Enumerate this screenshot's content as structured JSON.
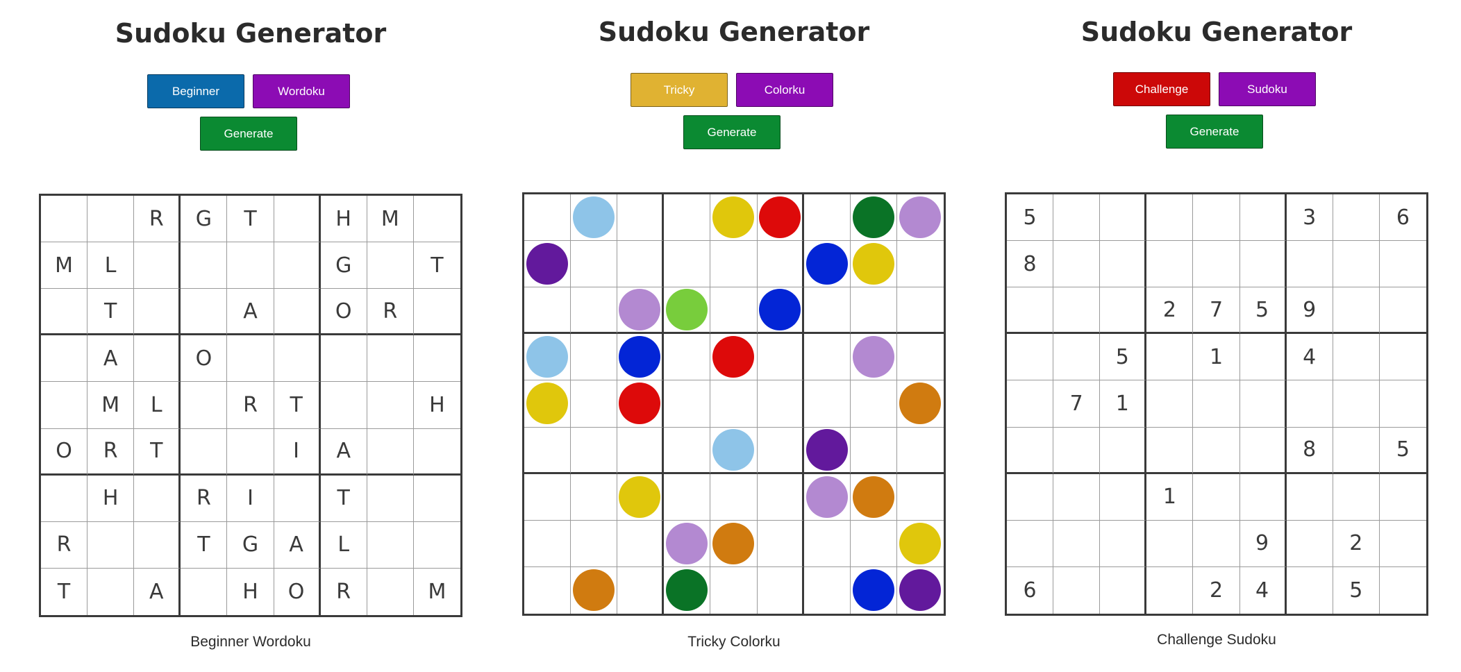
{
  "panels": [
    {
      "title": "Sudoku Generator",
      "difficulty_button": {
        "label": "Beginner",
        "color": "#0b6aab"
      },
      "mode_button": {
        "label": "Wordoku",
        "color": "#8c0cb4"
      },
      "generate_button": {
        "label": "Generate",
        "color": "#0b8a32"
      },
      "caption": "Beginner Wordoku",
      "grid_type": "text",
      "grid": [
        [
          "",
          "",
          "R",
          "G",
          "T",
          "",
          "H",
          "M",
          ""
        ],
        [
          "M",
          "L",
          "",
          "",
          "",
          "",
          "G",
          "",
          "T"
        ],
        [
          "",
          "T",
          "",
          "",
          "A",
          "",
          "O",
          "R",
          ""
        ],
        [
          "",
          "A",
          "",
          "O",
          "",
          "",
          "",
          "",
          ""
        ],
        [
          "",
          "M",
          "L",
          "",
          "R",
          "T",
          "",
          "",
          "H"
        ],
        [
          "O",
          "R",
          "T",
          "",
          "",
          "I",
          "A",
          "",
          ""
        ],
        [
          "",
          "H",
          "",
          "R",
          "I",
          "",
          "T",
          "",
          ""
        ],
        [
          "R",
          "",
          "",
          "T",
          "G",
          "A",
          "L",
          "",
          ""
        ],
        [
          "T",
          "",
          "A",
          "",
          "H",
          "O",
          "R",
          "",
          "M"
        ]
      ]
    },
    {
      "title": "Sudoku Generator",
      "difficulty_button": {
        "label": "Tricky",
        "color": "#e0b232"
      },
      "mode_button": {
        "label": "Colorku",
        "color": "#8c0cb4"
      },
      "generate_button": {
        "label": "Generate",
        "color": "#0b8a32"
      },
      "caption": "Tricky Colorku",
      "grid_type": "color",
      "palette": {
        "lb": "#8ec4e8",
        "ye": "#e0c70c",
        "re": "#dd0a0a",
        "dg": "#0a7326",
        "li": "#b389d1",
        "pu": "#62199c",
        "bl": "#0325d6",
        "lg": "#78cd3c",
        "or": "#d07b10"
      },
      "grid": [
        [
          "",
          "lb",
          "",
          "",
          "ye",
          "re",
          "",
          "dg",
          "li"
        ],
        [
          "pu",
          "",
          "",
          "",
          "",
          "",
          "bl",
          "ye",
          ""
        ],
        [
          "",
          "",
          "li",
          "lg",
          "",
          "bl",
          "",
          "",
          ""
        ],
        [
          "lb",
          "",
          "bl",
          "",
          "re",
          "",
          "",
          "li",
          ""
        ],
        [
          "ye",
          "",
          "re",
          "",
          "",
          "",
          "",
          "",
          "or"
        ],
        [
          "",
          "",
          "",
          "",
          "lb",
          "",
          "pu",
          "",
          ""
        ],
        [
          "",
          "",
          "ye",
          "",
          "",
          "",
          "li",
          "or",
          ""
        ],
        [
          "",
          "",
          "",
          "li",
          "or",
          "",
          "",
          "",
          "ye"
        ],
        [
          "",
          "or",
          "",
          "dg",
          "",
          "",
          "",
          "bl",
          "pu"
        ]
      ]
    },
    {
      "title": "Sudoku Generator",
      "difficulty_button": {
        "label": "Challenge",
        "color": "#cc0808"
      },
      "mode_button": {
        "label": "Sudoku",
        "color": "#8c0cb4"
      },
      "generate_button": {
        "label": "Generate",
        "color": "#0b8a32"
      },
      "caption": "Challenge Sudoku",
      "grid_type": "text",
      "grid": [
        [
          "5",
          "",
          "",
          "",
          "",
          "",
          "3",
          "",
          "6"
        ],
        [
          "8",
          "",
          "",
          "",
          "",
          "",
          "",
          "",
          ""
        ],
        [
          "",
          "",
          "",
          "2",
          "7",
          "5",
          "9",
          "",
          ""
        ],
        [
          "",
          "",
          "5",
          "",
          "1",
          "",
          "4",
          "",
          ""
        ],
        [
          "",
          "7",
          "1",
          "",
          "",
          "",
          "",
          "",
          ""
        ],
        [
          "",
          "",
          "",
          "",
          "",
          "",
          "8",
          "",
          "5"
        ],
        [
          "",
          "",
          "",
          "1",
          "",
          "",
          "",
          "",
          ""
        ],
        [
          "",
          "",
          "",
          "",
          "",
          "9",
          "",
          "2",
          ""
        ],
        [
          "6",
          "",
          "",
          "",
          "2",
          "4",
          "",
          "5",
          ""
        ]
      ]
    }
  ]
}
